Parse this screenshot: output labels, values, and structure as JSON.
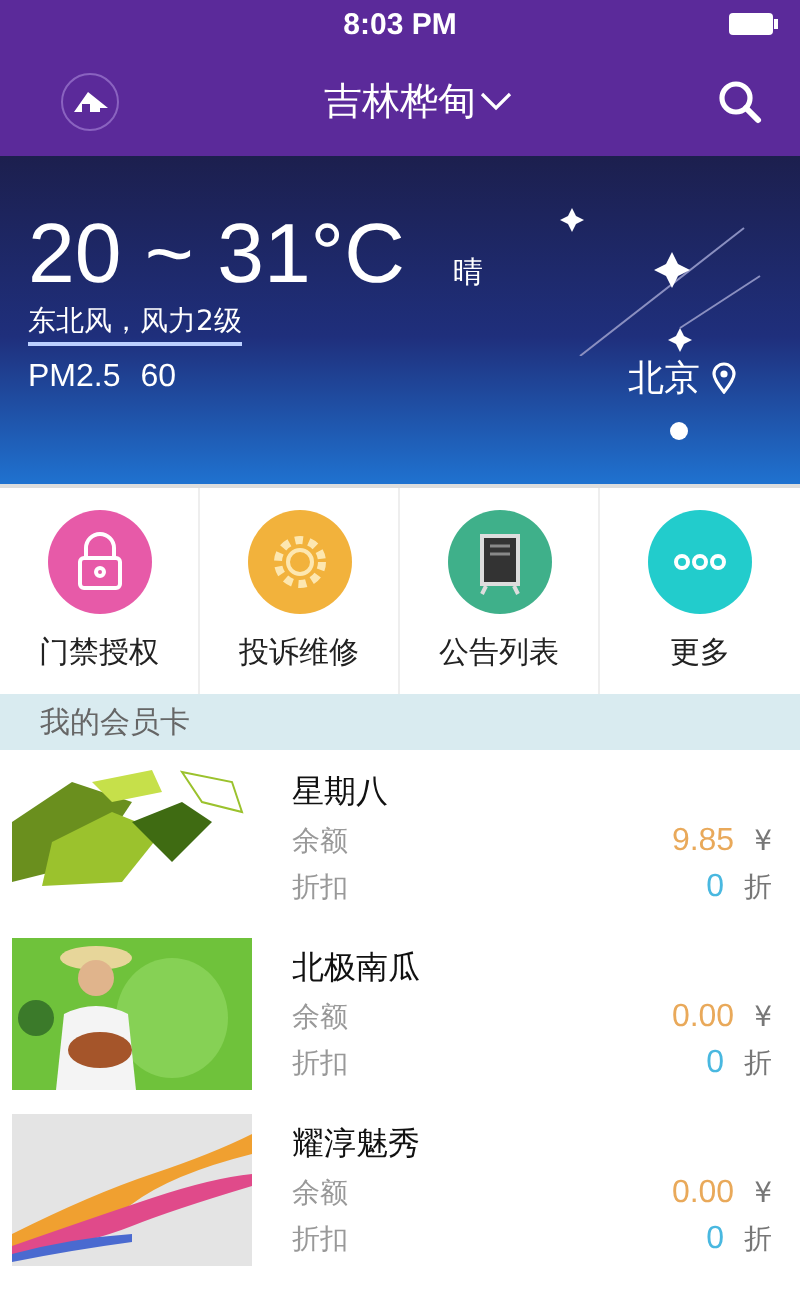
{
  "status_bar": {
    "time": "8:03 PM"
  },
  "header": {
    "city": "吉林桦甸"
  },
  "weather": {
    "temperature": "20 ~ 31°C",
    "condition": "晴",
    "wind": "东北风，风力2级",
    "pm_label": "PM2.5",
    "pm_value": "60",
    "location": "北京",
    "pages": [
      {
        "selected": true
      }
    ]
  },
  "shortcuts": [
    {
      "label": "门禁授权",
      "kind": "lock",
      "color": "#e75aa8"
    },
    {
      "label": "投诉维修",
      "kind": "gear",
      "color": "#f2b23c"
    },
    {
      "label": "公告列表",
      "kind": "board",
      "color": "#3fb08a"
    },
    {
      "label": "更多",
      "kind": "more",
      "color": "#22cccc"
    }
  ],
  "section": {
    "title": "我的会员卡"
  },
  "cards": [
    {
      "name": "星期八",
      "balance_label": "余额",
      "balance": "9.85",
      "currency": "¥",
      "discount_label": "折扣",
      "discount": "0",
      "discount_unit": "折",
      "kind": "picture"
    },
    {
      "name": "北极南瓜",
      "balance_label": "余额",
      "balance": "0.00",
      "currency": "¥",
      "discount_label": "折扣",
      "discount": "0",
      "discount_unit": "折",
      "kind": "picture"
    },
    {
      "name": "耀淳魅秀",
      "balance_label": "余额",
      "balance": "0.00",
      "currency": "¥",
      "discount_label": "折扣",
      "discount": "0",
      "discount_unit": "折",
      "kind": "picture"
    }
  ]
}
